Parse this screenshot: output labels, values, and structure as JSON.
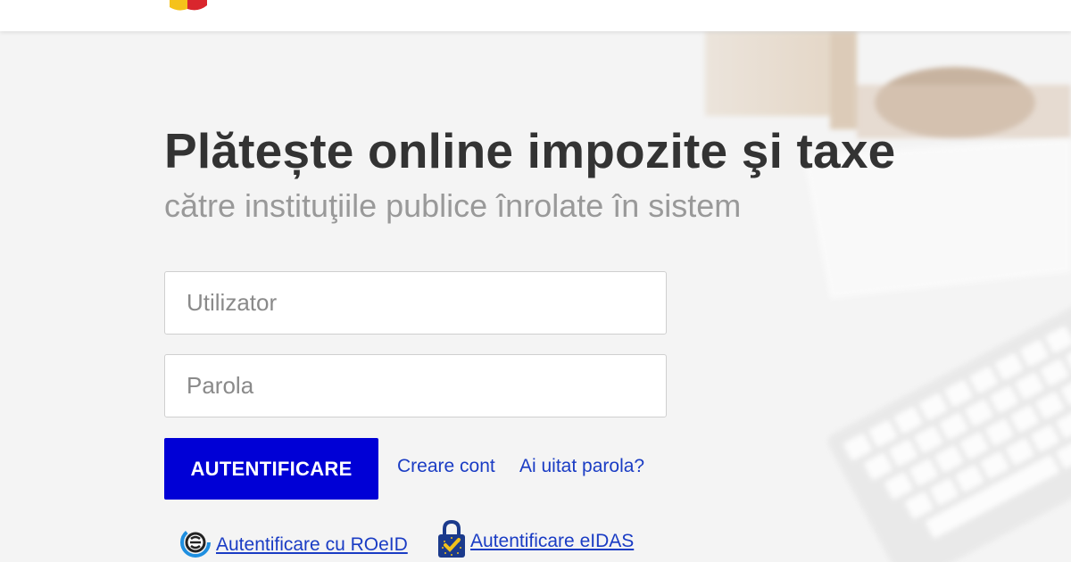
{
  "hero": {
    "title": "Plătește online impozite şi taxe",
    "subtitle": "către instituţiile publice înrolate în sistem"
  },
  "login_form": {
    "username_placeholder": "Utilizator",
    "username_value": "",
    "password_placeholder": "Parola",
    "password_value": "",
    "submit_label": "AUTENTIFICARE",
    "create_account_label": "Creare cont",
    "forgot_password_label": "Ai uitat parola?"
  },
  "alternative_auth": {
    "roeid_label": "Autentificare cu ROeID",
    "roeid_icon": "roeid-logo-icon",
    "eidas_label": "Autentificare eIDAS",
    "eidas_icon": "eidas-padlock-icon"
  },
  "colors": {
    "primary_button": "#0000d6",
    "link": "#1a3cc4",
    "title": "#333333",
    "subtitle": "#999999",
    "background": "#f4f4f4"
  }
}
